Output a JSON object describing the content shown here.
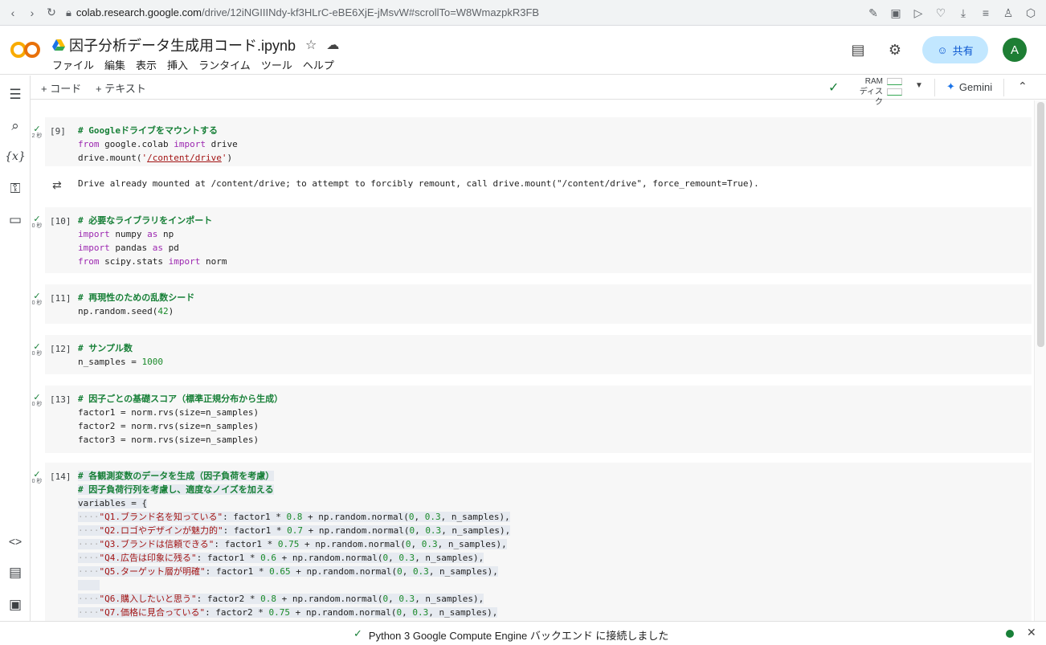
{
  "browser": {
    "url_host": "colab.research.google.com",
    "url_path": "/drive/12iNGIIINdy-kf3HLrC-eBE6XjE-jMsvW#scrollTo=W8WmazpkR3FB"
  },
  "header": {
    "logo_text": "CO",
    "title": "因子分析データ生成用コード.ipynb",
    "menu": [
      "ファイル",
      "編集",
      "表示",
      "挿入",
      "ランタイム",
      "ツール",
      "ヘルプ"
    ],
    "share_label": "共有",
    "avatar_letter": "A"
  },
  "toolbar": {
    "add_code": "+ コード",
    "add_text": "+ テキスト",
    "ram_label": "RAM",
    "disk_label": "ディスク",
    "gemini_label": "Gemini"
  },
  "cells": [
    {
      "count": "[9]",
      "time": "2 秒",
      "lines": [
        "# Googleドライブをマウントする",
        "from google.colab import drive",
        "drive.mount('/content/drive')"
      ]
    },
    {
      "count": "[10]",
      "time": "0 秒",
      "lines": [
        "# 必要なライブラリをインポート",
        "import numpy as np",
        "import pandas as pd",
        "from scipy.stats import norm"
      ]
    },
    {
      "count": "[11]",
      "time": "0 秒",
      "lines": [
        "# 再現性のための乱数シード",
        "np.random.seed(42)"
      ]
    },
    {
      "count": "[12]",
      "time": "0 秒",
      "lines": [
        "# サンプル数",
        "n_samples = 1000"
      ]
    },
    {
      "count": "[13]",
      "time": "0 秒",
      "lines": [
        "# 因子ごとの基礎スコア（標準正規分布から生成）",
        "factor1 = norm.rvs(size=n_samples)",
        "factor2 = norm.rvs(size=n_samples)",
        "factor3 = norm.rvs(size=n_samples)"
      ]
    },
    {
      "count": "[14]",
      "time": "0 秒",
      "lines": [
        "# 各観測変数のデータを生成（因子負荷を考慮）",
        "# 因子負荷行列を考慮し、適度なノイズを加える",
        "variables = {",
        "\"Q1.ブランド名を知っている\": factor1 * 0.8 + np.random.normal(0, 0.3, n_samples),",
        "\"Q2.ロゴやデザインが魅力的\": factor1 * 0.7 + np.random.normal(0, 0.3, n_samples),",
        "\"Q3.ブランドは信頼できる\": factor1 * 0.75 + np.random.normal(0, 0.3, n_samples),",
        "\"Q4.広告は印象に残る\": factor1 * 0.6 + np.random.normal(0, 0.3, n_samples),",
        "\"Q5.ターゲット層が明確\": factor1 * 0.65 + np.random.normal(0, 0.3, n_samples),",
        "",
        "\"Q6.購入したいと思う\": factor2 * 0.8 + np.random.normal(0, 0.3, n_samples),",
        "\"Q7.価格に見合っている\": factor2 * 0.75 + np.random.normal(0, 0.3, n_samples),"
      ]
    }
  ],
  "output": {
    "text": "Drive already mounted at /content/drive; to attempt to forcibly remount, call drive.mount(\"/content/drive\", force_remount=True)."
  },
  "status": {
    "text": "Python 3 Google Compute Engine バックエンド に接続しました"
  },
  "colors": {
    "accent": "#0b57d0",
    "ok_green": "#188038",
    "keyword": "#9c27b0",
    "string": "#a31515"
  }
}
